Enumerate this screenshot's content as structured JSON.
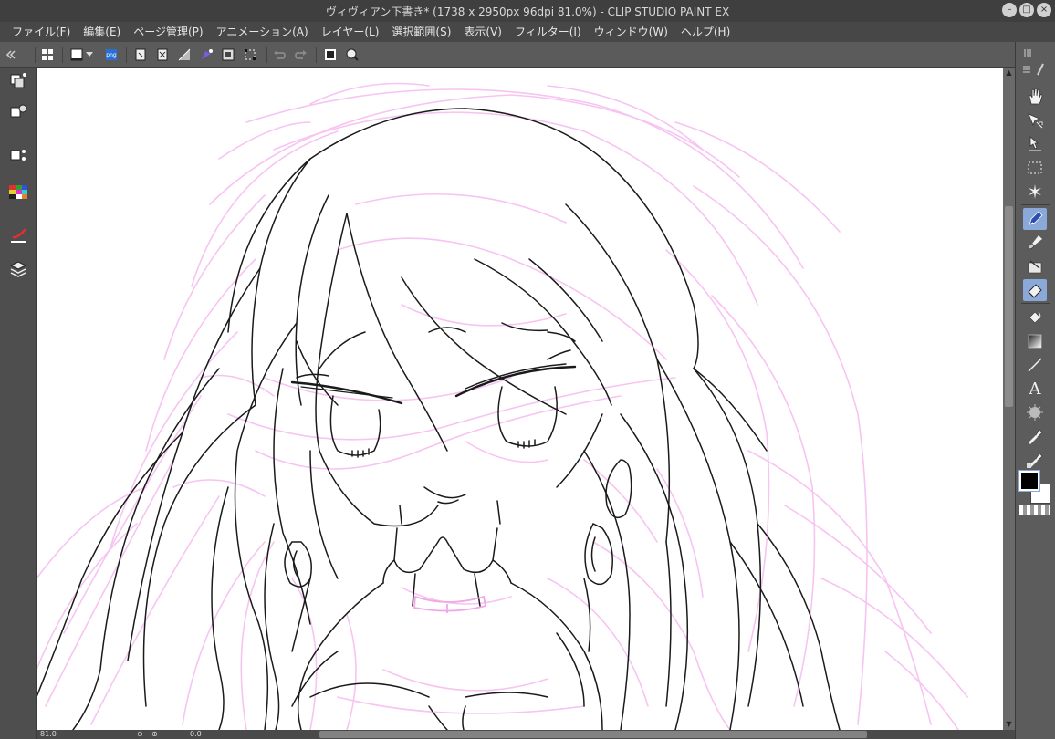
{
  "window": {
    "title": "ヴィヴィアン下書き* (1738 x 2950px 96dpi 81.0%)  - CLIP STUDIO PAINT EX",
    "min_label": "–",
    "max_label": "□",
    "close_label": "×"
  },
  "menu": [
    "ファイル(F)",
    "編集(E)",
    "ページ管理(P)",
    "アニメーション(A)",
    "レイヤー(L)",
    "選択範囲(S)",
    "表示(V)",
    "フィルター(I)",
    "ウィンドウ(W)",
    "ヘルプ(H)"
  ],
  "commandbar": {
    "icons": [
      "collapse-left-icon",
      "grid-icon",
      "new-canvas-icon",
      "dropdown-icon",
      "export-png-icon",
      "clear-icon",
      "clear-outside-icon",
      "fill-icon",
      "transform-icon",
      "layer-property-icon",
      "select-range-icon",
      "undo-icon",
      "redo-icon",
      "frame-icon",
      "lasso-icon"
    ],
    "export_label": "png"
  },
  "status": {
    "zoom": "81.0",
    "angle": "0.0"
  },
  "right_palette": {
    "tools": [
      "hand-tool-icon",
      "move-tool-icon",
      "operation-tool-icon",
      "selection-tool-icon",
      "auto-select-icon",
      "pen-tool-icon",
      "brush-tool-icon",
      "decoration-tool-icon",
      "eraser-tool-icon",
      "fill-tool-icon",
      "gradient-tool-icon",
      "figure-tool-icon",
      "text-tool-icon",
      "blend-tool-icon",
      "eyedropper-tool-icon",
      "eyedropper-alt-icon"
    ],
    "selected": [
      "pen-tool-icon",
      "eraser-tool-icon"
    ],
    "text_tool_glyph": "A",
    "main_color": "#000000",
    "sub_color": "#ffffff"
  },
  "colors": {
    "sketch_pink": "#f7c4f2",
    "lineart": "#1a1a1a",
    "canvas_bg": "#ffffff"
  }
}
